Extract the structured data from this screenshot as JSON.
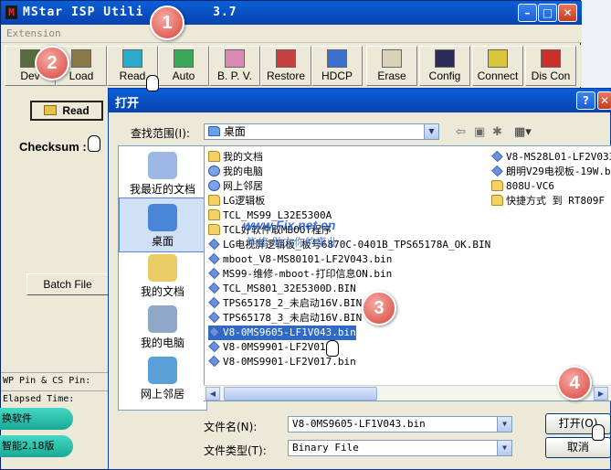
{
  "app": {
    "title": "MStar ISP Utility 3.7",
    "title_left": "MStar ISP Utili",
    "title_right": "3.7",
    "menu": "Extension",
    "toolbar": [
      {
        "label": "Dev",
        "icon": "device-icon"
      },
      {
        "label": "Load",
        "icon": "load-icon"
      },
      {
        "label": "Read",
        "icon": "read-icon"
      },
      {
        "label": "Auto",
        "icon": "auto-icon"
      },
      {
        "label": "B. P. V.",
        "icon": "bpv-icon"
      },
      {
        "label": "Restore",
        "icon": "restore-icon"
      },
      {
        "label": "HDCP",
        "icon": "hdcp-icon"
      },
      {
        "label": "Erase",
        "icon": "erase-icon"
      },
      {
        "label": "Config",
        "icon": "config-icon"
      },
      {
        "label": "Connect",
        "icon": "connect-icon"
      },
      {
        "label": "Dis Con",
        "icon": "disconnect-icon"
      }
    ],
    "read_button": "Read",
    "checksum_label": "Checksum :",
    "batch_button": "Batch File",
    "status_wp": "WP Pin & CS Pin:",
    "status_elapsed": "Elapsed Time:",
    "taskbar": [
      "换软件",
      "智能2.18版"
    ]
  },
  "dialog": {
    "title": "打开",
    "help": "?",
    "close": "✕",
    "look_in_label": "查找范围(I):",
    "look_in_value": "桌面",
    "places": [
      {
        "label": "我最近的文档",
        "icon": "recent-icon"
      },
      {
        "label": "桌面",
        "icon": "desktop-icon"
      },
      {
        "label": "我的文档",
        "icon": "my-documents-icon"
      },
      {
        "label": "我的电脑",
        "icon": "my-computer-icon"
      },
      {
        "label": "网上邻居",
        "icon": "network-icon"
      }
    ],
    "files_col1": [
      {
        "name": "我的文档",
        "kind": "folder"
      },
      {
        "name": "我的电脑",
        "kind": "sys"
      },
      {
        "name": "网上邻居",
        "kind": "sys"
      },
      {
        "name": "LG逻辑板",
        "kind": "folder"
      },
      {
        "name": "TCL_MS99_L32E5300A",
        "kind": "folder"
      },
      {
        "name": "TCL好软件取MBOOT程序",
        "kind": "folder"
      },
      {
        "name": "LG电视屏逻辑板_板号6870C-0401B_TPS65178A_OK.BIN",
        "kind": "file"
      },
      {
        "name": "mboot_V8-MS80101-LF2V043.bin",
        "kind": "file"
      },
      {
        "name": "MS99-维修-mboot-打印信息ON.bin",
        "kind": "file"
      },
      {
        "name": "TCL_MS801_32E5300D.BIN",
        "kind": "file"
      },
      {
        "name": "TPS65178_2_未启动16V.BIN",
        "kind": "file"
      },
      {
        "name": "TPS65178_3_未启动16V.BIN",
        "kind": "file"
      },
      {
        "name": "V8-0MS9605-LF1V043.bin",
        "kind": "file"
      },
      {
        "name": "V8-0MS9901-LF2V016.",
        "kind": "file"
      },
      {
        "name": "V8-0MS9901-LF2V017.bin",
        "kind": "file"
      }
    ],
    "files_col2": [
      {
        "name": "V8-MS28L01-LF2V033.b",
        "kind": "file"
      },
      {
        "name": "朗明V29电视板-19W.b",
        "kind": "file"
      },
      {
        "name": "808U-VC6",
        "kind": "folder"
      },
      {
        "name": "快捷方式 到 RT809F",
        "kind": "folder"
      }
    ],
    "filename_label": "文件名(N):",
    "filename_value": "V8-0MS9605-LF1V043.bin",
    "filetype_label": "文件类型(T):",
    "filetype_value": "Binary File",
    "open_button": "打开(O)",
    "cancel_button": "取消"
  },
  "watermark": {
    "line1": "www.Fix.net.cn",
    "line2": "毕修·助力你的事业"
  },
  "callouts": [
    "1",
    "2",
    "3",
    "4"
  ]
}
